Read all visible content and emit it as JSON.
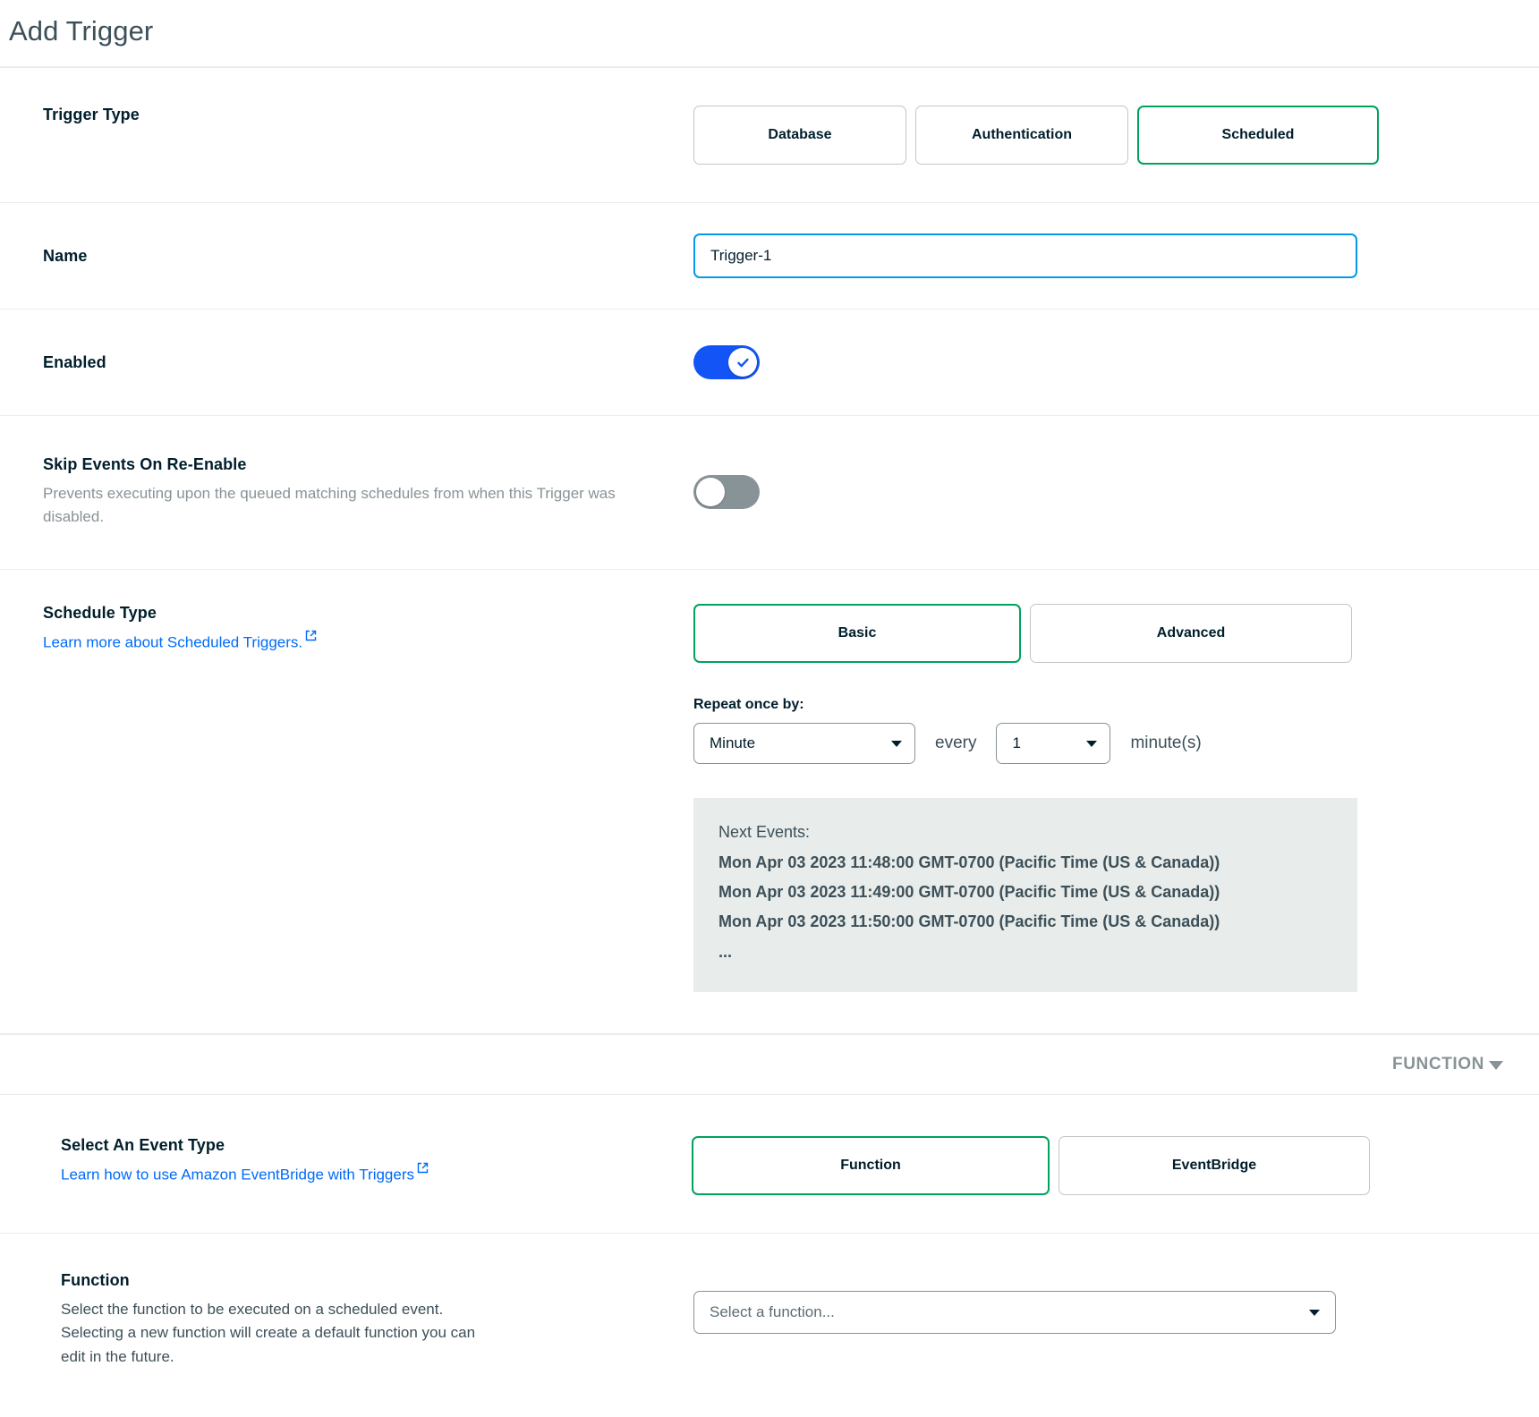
{
  "header": {
    "title": "Add Trigger"
  },
  "trigger_type": {
    "label": "Trigger Type",
    "options": [
      {
        "label": "Database",
        "selected": false
      },
      {
        "label": "Authentication",
        "selected": false
      },
      {
        "label": "Scheduled",
        "selected": true
      }
    ]
  },
  "name": {
    "label": "Name",
    "value": "Trigger-1",
    "placeholder": "Trigger-1"
  },
  "enabled": {
    "label": "Enabled",
    "state": "on",
    "icon": "check-icon"
  },
  "skip_events": {
    "label": "Skip Events On Re-Enable",
    "description": "Prevents executing upon the queued matching schedules from when this Trigger was disabled.",
    "state": "off"
  },
  "schedule_type": {
    "label": "Schedule Type",
    "link_text": "Learn more about Scheduled Triggers.",
    "link_icon": "external-link-icon",
    "options": [
      {
        "label": "Basic",
        "selected": true
      },
      {
        "label": "Advanced",
        "selected": false
      }
    ],
    "repeat": {
      "label": "Repeat once by:",
      "unit_value": "Minute",
      "every_word": "every",
      "count_value": "1",
      "unit_suffix": "minute(s)"
    },
    "next_events": {
      "title": "Next Events:",
      "items": [
        "Mon Apr 03 2023 11:48:00 GMT-0700 (Pacific Time (US & Canada))",
        "Mon Apr 03 2023 11:49:00 GMT-0700 (Pacific Time (US & Canada))",
        "Mon Apr 03 2023 11:50:00 GMT-0700 (Pacific Time (US & Canada))"
      ],
      "ellipsis": "..."
    }
  },
  "function_section": {
    "bar_label": "FUNCTION",
    "bar_icon": "chevron-down-icon"
  },
  "event_type": {
    "label": "Select An Event Type",
    "link_text": "Learn how to use Amazon EventBridge with Triggers",
    "link_icon": "external-link-icon",
    "options": [
      {
        "label": "Function",
        "selected": true
      },
      {
        "label": "EventBridge",
        "selected": false
      }
    ]
  },
  "function_field": {
    "label": "Function",
    "description": "Select the function to be executed on a scheduled event. Selecting a new function will create a default function you can edit in the future.",
    "select_placeholder": "Select a function...",
    "caret_icon": "caret-down-icon"
  },
  "colors": {
    "selected_green": "#00A35C",
    "focus_blue": "#0498EC",
    "toggle_on_blue": "#1254F5",
    "toggle_off_grey": "#889397",
    "link_blue": "#016BF8",
    "panel_grey": "#E8EDEB",
    "text_dark": "#001E2B",
    "text_muted": "#889397"
  }
}
